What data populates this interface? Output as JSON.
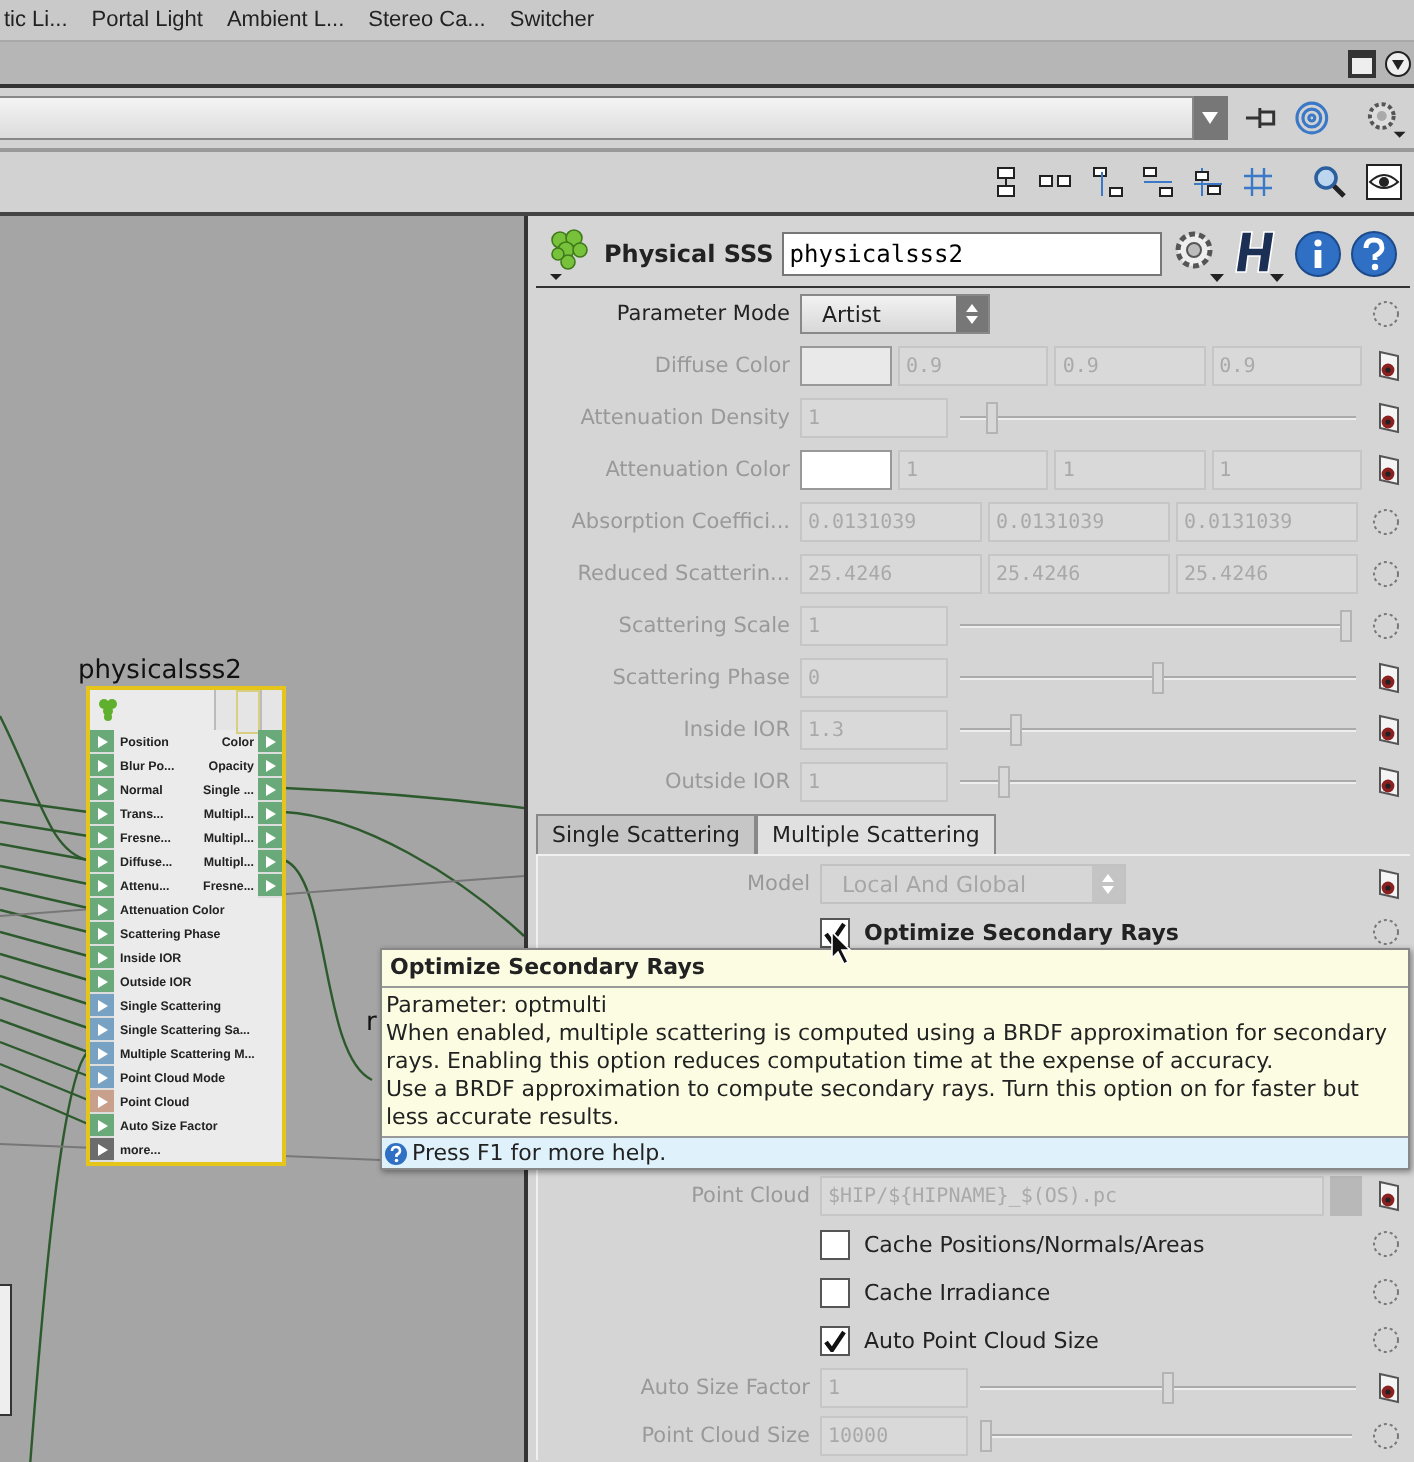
{
  "shelf": {
    "tools": [
      "tic Li...",
      "Portal Light",
      "Ambient L...",
      "Stereo Ca...",
      "Switcher"
    ]
  },
  "network": {
    "node": {
      "name": "physicalsss2",
      "rows": [
        {
          "input": "Position",
          "output": "Color",
          "color": "#6aa97a"
        },
        {
          "input": "Blur Po...",
          "output": "Opacity",
          "color": "#6aa97a"
        },
        {
          "input": "Normal",
          "output": "Single ...",
          "color": "#6aa97a"
        },
        {
          "input": "Trans...",
          "output": "Multipl...",
          "color": "#6aa97a"
        },
        {
          "input": "Fresne...",
          "output": "Multipl...",
          "color": "#6aa97a"
        },
        {
          "input": "Diffuse...",
          "output": "Multipl...",
          "color": "#6aa97a"
        },
        {
          "input": "Attenu...",
          "output": "Fresne...",
          "color": "#6aa97a"
        },
        {
          "input": "Attenuation Color",
          "color": "#6aa97a"
        },
        {
          "input": "Scattering Phase",
          "color": "#6aa97a"
        },
        {
          "input": "Inside IOR",
          "color": "#6aa97a"
        },
        {
          "input": "Outside IOR",
          "color": "#6aa97a"
        },
        {
          "input": "Single Scattering",
          "color": "#78a2c4"
        },
        {
          "input": "Single Scattering Sa...",
          "color": "#78a2c4"
        },
        {
          "input": "Multiple Scattering M...",
          "color": "#78a2c4"
        },
        {
          "input": "Point Cloud Mode",
          "color": "#78a2c4"
        },
        {
          "input": "Point Cloud",
          "color": "#c9a08b"
        },
        {
          "input": "Auto Size Factor",
          "color": "#6aa97a"
        },
        {
          "input": "more...",
          "color": "#6c6c6c"
        }
      ]
    },
    "other_node_label": "r"
  },
  "parameters": {
    "node_type": "Physical SSS",
    "node_name": "physicalsss2",
    "params": [
      {
        "label": "Parameter Mode",
        "kind": "menu",
        "value": "Artist",
        "disabled": false,
        "plug": false
      },
      {
        "label": "Diffuse Color",
        "kind": "color",
        "color": "#e9e9e9",
        "values": [
          "0.9",
          "0.9",
          "0.9"
        ],
        "disabled": true,
        "plug": true
      },
      {
        "label": "Attenuation Density",
        "kind": "slider",
        "value": "1",
        "level": 0.07,
        "disabled": true,
        "plug": true
      },
      {
        "label": "Attenuation Color",
        "kind": "color",
        "color": "#ffffff",
        "values": [
          "1",
          "1",
          "1"
        ],
        "disabled": true,
        "plug": true
      },
      {
        "label": "Absorption Coeffici...",
        "kind": "vector",
        "values": [
          "0.0131039",
          "0.0131039",
          "0.0131039"
        ],
        "disabled": true,
        "plug": false
      },
      {
        "label": "Reduced Scatterin...",
        "kind": "vector",
        "values": [
          "25.4246",
          "25.4246",
          "25.4246"
        ],
        "disabled": true,
        "plug": false
      },
      {
        "label": "Scattering Scale",
        "kind": "slider",
        "value": "1",
        "level": 1,
        "disabled": true,
        "plug": false
      },
      {
        "label": "Scattering Phase",
        "kind": "slider",
        "value": "0",
        "level": 0.5,
        "disabled": true,
        "plug": true
      },
      {
        "label": "Inside IOR",
        "kind": "slider",
        "value": "1.3",
        "level": 0.13,
        "disabled": true,
        "plug": true
      },
      {
        "label": "Outside IOR",
        "kind": "slider",
        "value": "1",
        "level": 0.1,
        "disabled": true,
        "plug": true
      }
    ],
    "tabs": [
      {
        "label": "Single Scattering",
        "selected": false
      },
      {
        "label": "Multiple Scattering",
        "selected": true
      }
    ],
    "tab_params": [
      {
        "label": "Model",
        "kind": "menu",
        "value": "Local And Global",
        "disabled": true,
        "plug": true
      },
      {
        "label": "Optimize Secondary Rays",
        "kind": "checkbox",
        "checked": true,
        "hovered": true,
        "disabled": false,
        "plug": false
      },
      {
        "label": "Point Cloud",
        "kind": "file",
        "value": "$HIP/${HIPNAME}_$(OS).pc",
        "disabled": true,
        "plug": true
      },
      {
        "label": "Cache Positions/Normals/Areas",
        "kind": "checkbox",
        "checked": false,
        "hovered": false,
        "disabled": false,
        "plug": false
      },
      {
        "label": "Cache Irradiance",
        "kind": "checkbox",
        "checked": false,
        "hovered": false,
        "disabled": false,
        "plug": false
      },
      {
        "label": "Auto Point Cloud Size",
        "kind": "checkbox",
        "checked": true,
        "hovered": false,
        "disabled": false,
        "plug": false
      },
      {
        "label": "Auto Size Factor",
        "kind": "slider",
        "value": "1",
        "level": 0.5,
        "disabled": true,
        "plug": true
      },
      {
        "label": "Point Cloud Size",
        "kind": "slider",
        "value": "10000",
        "level": 0.0,
        "disabled": true,
        "plug": false
      }
    ]
  },
  "tooltip": {
    "title": "Optimize Secondary Rays",
    "lines": [
      "Parameter: optmulti",
      "When enabled, multiple scattering is computed using a BRDF approximation for secondary rays.  Enabling this option reduces computation time at the expense of accuracy.",
      "Use a BRDF approximation to compute secondary rays. Turn this option on for faster but less accurate results."
    ],
    "footer": "Press F1 for more help."
  }
}
